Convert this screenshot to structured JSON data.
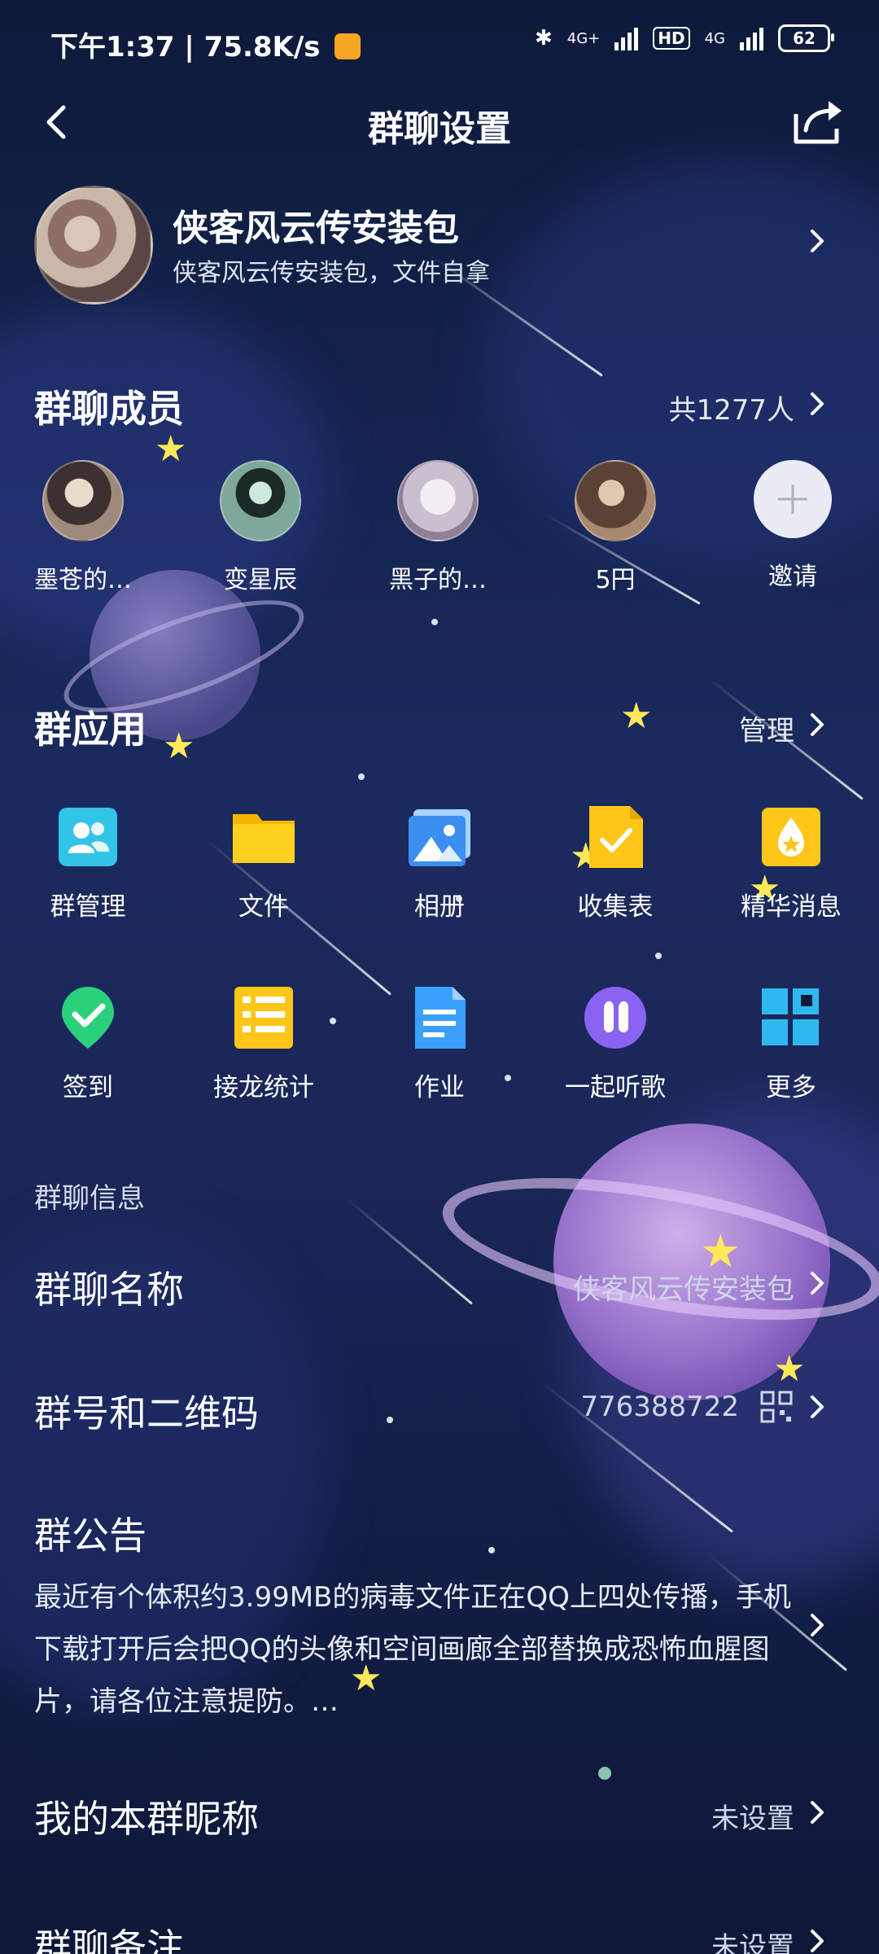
{
  "status_bar": {
    "time_speed": "下午1:37 | 75.8K/s",
    "network1": "4G+",
    "hd": "HD",
    "network2": "4G",
    "battery": "62"
  },
  "header": {
    "title": "群聊设置"
  },
  "group": {
    "name": "侠客风云传安装包",
    "description": "侠客风云传安装包，文件自拿"
  },
  "members_section": {
    "title": "群聊成员",
    "count": "共1277人",
    "members": [
      {
        "name": "墨苍的…"
      },
      {
        "name": "变星辰"
      },
      {
        "name": "黑子的…"
      },
      {
        "name": "5円"
      },
      {
        "name": "邀请"
      }
    ]
  },
  "apps_section": {
    "title": "群应用",
    "manage": "管理",
    "apps": [
      {
        "label": "群管理",
        "icon": "group-manage-icon"
      },
      {
        "label": "文件",
        "icon": "folder-icon"
      },
      {
        "label": "相册",
        "icon": "album-icon"
      },
      {
        "label": "收集表",
        "icon": "form-icon"
      },
      {
        "label": "精华消息",
        "icon": "essence-icon"
      },
      {
        "label": "签到",
        "icon": "checkin-icon"
      },
      {
        "label": "接龙统计",
        "icon": "relay-icon"
      },
      {
        "label": "作业",
        "icon": "homework-icon"
      },
      {
        "label": "一起听歌",
        "icon": "music-icon"
      },
      {
        "label": "更多",
        "icon": "more-icon"
      }
    ]
  },
  "info_section": {
    "label": "群聊信息",
    "name_row": {
      "title": "群聊名称",
      "value": "侠客风云传安装包"
    },
    "number_row": {
      "title": "群号和二维码",
      "value": "776388722"
    },
    "notice": {
      "title": "群公告",
      "text": "最近有个体积约3.99MB的病毒文件正在QQ上四处传播，手机下载打开后会把QQ的头像和空间画廊全部替换成恐怖血腥图片，请各位注意提防。…"
    },
    "nickname_row": {
      "title": "我的本群昵称",
      "value": "未设置"
    },
    "remark_row": {
      "title": "群聊备注",
      "value": "未设置"
    }
  },
  "colors": {
    "background": "#1a2656",
    "text": "#ffffff",
    "accent_yellow": "#ffd21f",
    "accent_blue": "#3aa0ff"
  }
}
